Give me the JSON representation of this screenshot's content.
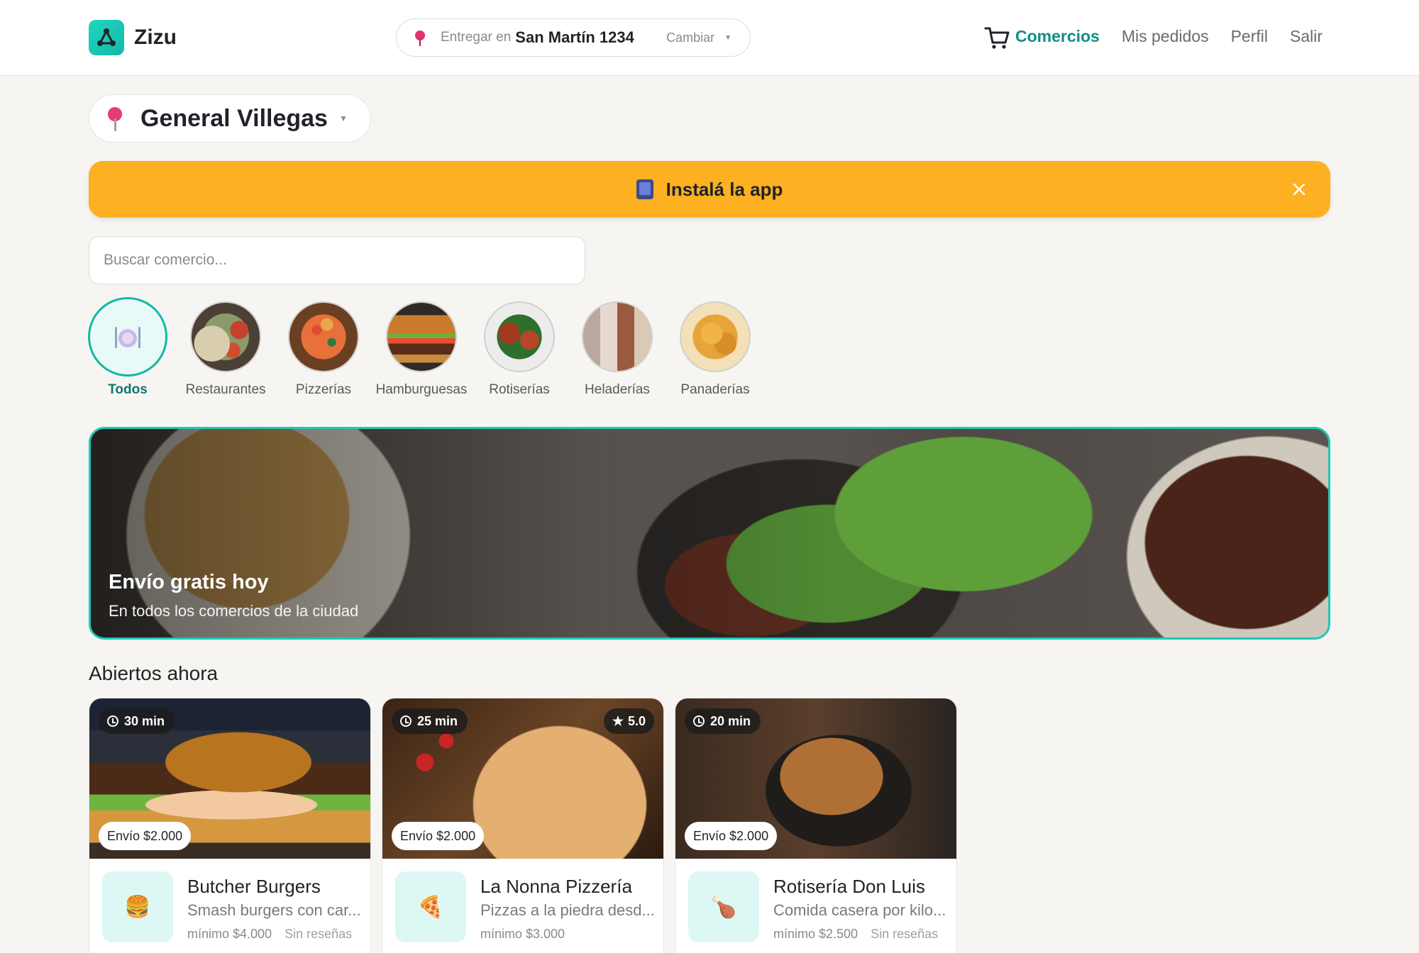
{
  "app": {
    "name": "Zizu",
    "accent": "#0f8f82",
    "banner_color": "#fdb022"
  },
  "address": {
    "prefix": "Entregar en",
    "value": "San Martín 1234",
    "change_label": "Cambiar"
  },
  "nav": {
    "items": [
      "Comercios",
      "Mis pedidos",
      "Perfil",
      "Salir"
    ],
    "active": "Comercios",
    "cart_icon": "cart-icon"
  },
  "city": {
    "name": "General Villegas"
  },
  "install_banner": {
    "text": "Instalá la app"
  },
  "search": {
    "placeholder": "Buscar comercio..."
  },
  "categories": [
    {
      "label": "Todos",
      "active": true
    },
    {
      "label": "Restaurantes"
    },
    {
      "label": "Pizzerías"
    },
    {
      "label": "Hamburguesas"
    },
    {
      "label": "Rotiserías"
    },
    {
      "label": "Heladerías"
    },
    {
      "label": "Panaderías"
    }
  ],
  "promo": {
    "title": "Envío gratis hoy",
    "subtitle": "En todos los comercios de la ciudad"
  },
  "section_title": "Abiertos ahora",
  "stores": [
    {
      "name": "Butcher Burgers",
      "description": "Smash burgers con car...",
      "minimum": "mínimo $4.000",
      "reviews": "Sin reseñas",
      "time": "30 min",
      "fee": "Envío $2.000",
      "icon": "🍔"
    },
    {
      "name": "La Nonna Pizzería",
      "description": "Pizzas a la piedra desd...",
      "minimum": "mínimo $3.000",
      "time": "25 min",
      "rating": "5.0",
      "fee": "Envío $2.000",
      "icon": "🍕"
    },
    {
      "name": "Rotisería Don Luis",
      "description": "Comida casera por kilo...",
      "minimum": "mínimo $2.500",
      "reviews": "Sin reseñas",
      "time": "20 min",
      "fee": "Envío $2.000",
      "icon": "🍗"
    }
  ]
}
